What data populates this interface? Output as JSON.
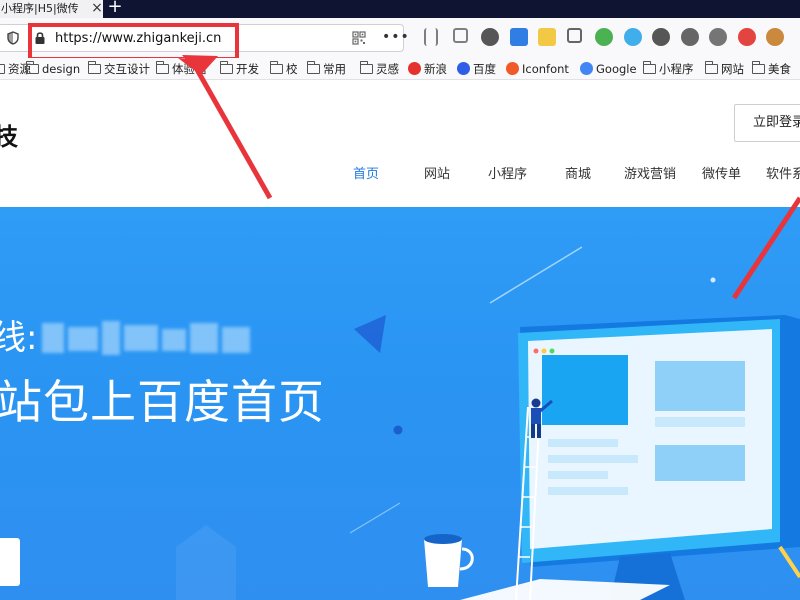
{
  "browser": {
    "tab_title": "小程序|H5|微传",
    "tab_close": "×",
    "new_tab": "+",
    "url": "https://www.zhigankeji.cn",
    "more": "•••"
  },
  "toolbar_icons": [
    {
      "name": "library-icon",
      "color": "#555555"
    },
    {
      "name": "sidebar-icon",
      "color": "#555555"
    },
    {
      "name": "account-icon",
      "color": "#444444"
    },
    {
      "name": "download-icon",
      "color": "#1a6fe0"
    },
    {
      "name": "extension-yellow-icon",
      "color": "#f2c230"
    },
    {
      "name": "crop-icon",
      "color": "#333333"
    },
    {
      "name": "extension-green-icon",
      "color": "#38a840"
    },
    {
      "name": "cloud-icon",
      "color": "#2aa5e8"
    },
    {
      "name": "chat-icon",
      "color": "#444444"
    },
    {
      "name": "bubble-icon",
      "color": "#555555"
    },
    {
      "name": "gear-icon",
      "color": "#666666"
    },
    {
      "name": "adblock-icon",
      "color": "#e0302a"
    },
    {
      "name": "monkey-icon",
      "color": "#c47c28"
    }
  ],
  "bookmarks": [
    {
      "label": "资源",
      "type": "folder"
    },
    {
      "label": "design",
      "type": "folder"
    },
    {
      "label": "交互设计",
      "type": "folder"
    },
    {
      "label": "体验馆",
      "type": "folder"
    },
    {
      "label": "开发",
      "type": "folder"
    },
    {
      "label": "校",
      "type": "folder"
    },
    {
      "label": "常用",
      "type": "folder"
    },
    {
      "label": "灵感",
      "type": "folder"
    },
    {
      "label": "新浪",
      "type": "site",
      "color": "#e5322d"
    },
    {
      "label": "百度",
      "type": "site",
      "color": "#2e5ee8"
    },
    {
      "label": "Iconfont",
      "type": "site",
      "color": "#f05a28"
    },
    {
      "label": "Google",
      "type": "site",
      "color": "#4285f4"
    },
    {
      "label": "小程序",
      "type": "folder"
    },
    {
      "label": "网站",
      "type": "folder"
    },
    {
      "label": "美食",
      "type": "folder"
    }
  ],
  "page": {
    "logo_text": "技",
    "login_label": "立即登录",
    "nav": [
      {
        "label": "首页",
        "active": true
      },
      {
        "label": "网站",
        "active": false
      },
      {
        "label": "小程序",
        "active": false
      },
      {
        "label": "商城",
        "active": false
      },
      {
        "label": "游戏营销",
        "active": false
      },
      {
        "label": "微传单",
        "active": false
      },
      {
        "label": "软件系",
        "active": false
      }
    ],
    "hero_line1_prefix": "线:",
    "hero_line2": "站包上百度首页"
  },
  "colors": {
    "accent": "#1f7ae0",
    "hero_bg": "#2f9cf6",
    "annotation": "#e8343b"
  }
}
